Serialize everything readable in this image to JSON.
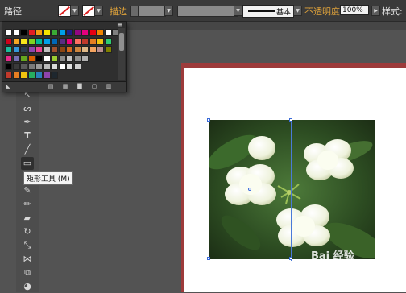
{
  "control_bar": {
    "path_label": "路径",
    "stroke_label": "描边",
    "brush_label": "基本",
    "opacity_label": "不透明度",
    "opacity_value": "100%",
    "style_label": "样式:",
    "fill_icon": "no-fill-swatch",
    "stroke_icon": "no-stroke-swatch"
  },
  "tooltip": "矩形工具 (M)",
  "toolbar": {
    "tools": [
      "selection-tool",
      "lasso-tool",
      "pen-tool",
      "type-tool",
      "line-tool",
      "rectangle-tool",
      "paintbrush-tool",
      "pencil-tool",
      "eraser-tool",
      "rotate-tool",
      "scale-tool",
      "width-tool",
      "free-transform-tool",
      "shape-builder-tool"
    ],
    "active_tool": "rectangle-tool"
  },
  "swatch_panel": {
    "rows": [
      [
        "#ffffff",
        "#ffffff",
        "#000000",
        "#e31e24",
        "#f39c12",
        "#f5e400",
        "#3aaa35",
        "#00a0e9",
        "#1d2088",
        "#920783",
        "#e4007f",
        "#e60012",
        "#f08300",
        "#ffffff",
        "#7f7f7f"
      ],
      [
        "#d0021b",
        "#f5a623",
        "#f8e71c",
        "#7ed321",
        "#00b894",
        "#00a0e9",
        "#0068b7",
        "#5a2d82",
        "#e4007f",
        "#ff6f61",
        "#c0392b",
        "#e67e22",
        "#f1c40f",
        "#2ecc71"
      ],
      [
        "#1abc9c",
        "#3498db",
        "#2c3e50",
        "#8e44ad",
        "#e84393",
        "#c0c0c0",
        "#a0522d",
        "#8b4513",
        "#d2691e",
        "#cd853f",
        "#deb887",
        "#f4a460",
        "#bc8f8f",
        "#808000"
      ],
      [
        "#e7298a",
        "#7570b3",
        "#66a61e",
        "#d95f02",
        "#000000",
        "#ffffff",
        "#9acd32",
        "#8b8b8b",
        "#c6c6c6",
        "#8f8f8f",
        "#b0b0b0"
      ],
      [
        "#000000",
        "#3a3a3a",
        "#5a5a5a",
        "#7a7a7a",
        "#9a9a9a",
        "#bababa",
        "#dadada",
        "#ffffff",
        "#e0e0e0",
        "#cfcfcf"
      ],
      [
        "#c0392b",
        "#e67e22",
        "#f1c40f",
        "#27ae60",
        "#2980b9",
        "#8e44ad",
        "#1e272e"
      ]
    ]
  },
  "watermark_text": "Bai 经验"
}
